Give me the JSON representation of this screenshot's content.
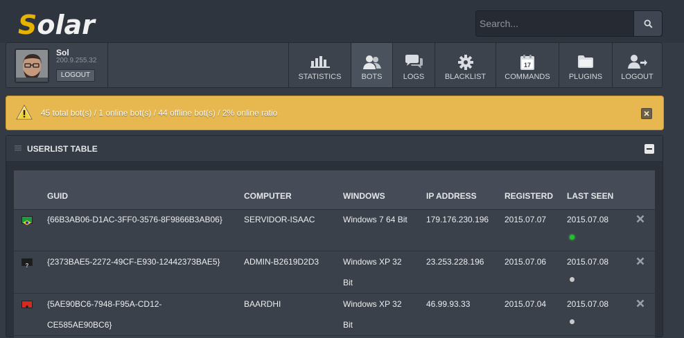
{
  "app": {
    "logo_rest": "olar",
    "logo_first": "S"
  },
  "search": {
    "placeholder": "Search..."
  },
  "user": {
    "name": "Sol",
    "ip": "200.9.255.32",
    "logout_label": "LOGOUT"
  },
  "nav": [
    {
      "label": "STATISTICS",
      "icon": "bar-chart-icon"
    },
    {
      "label": "BOTS",
      "icon": "users-icon",
      "active": true
    },
    {
      "label": "LOGS",
      "icon": "chat-bubbles-icon"
    },
    {
      "label": "BLACKLIST",
      "icon": "gear-icon"
    },
    {
      "label": "COMMANDS",
      "icon": "calendar-icon",
      "badge": "17"
    },
    {
      "label": "PLUGINS",
      "icon": "folder-icon"
    },
    {
      "label": "LOGOUT",
      "icon": "user-logout-icon"
    }
  ],
  "alert": {
    "text": "45 total bot(s) / 1 online bot(s) / 44 offline bot(s) / 2% online ratio"
  },
  "panel": {
    "title": "USERLIST TABLE"
  },
  "table": {
    "headers": [
      "GUID",
      "COMPUTER",
      "WINDOWS",
      "IP ADDRESS",
      "REGISTERD",
      "LAST SEEN"
    ],
    "rows": [
      {
        "flag": "brazil",
        "guid_1": "{66B3AB06-D1AC-3FF0-3576-8F9866B3AB06}",
        "guid_2": "",
        "computer": "SERVIDOR-ISAAC",
        "windows_1": "Windows 7 64 Bit",
        "windows_2": "",
        "ip": "179.176.230.196",
        "registered": "2015.07.07",
        "last_seen": "2015.07.08",
        "status": "online"
      },
      {
        "flag": "unknown",
        "guid_1": "{2373BAE5-2272-49CF-E930-12442373BAE5}",
        "guid_2": "",
        "computer": "ADMIN-B2619D2D3",
        "windows_1": "Windows XP 32",
        "windows_2": "Bit",
        "ip": "23.253.228.196",
        "registered": "2015.07.06",
        "last_seen": "2015.07.08",
        "status": "offline"
      },
      {
        "flag": "albania",
        "guid_1": "{5AE90BC6-7948-F95A-CD12-",
        "guid_2": "CE585AE90BC6}",
        "computer": "BAARDHI",
        "windows_1": "Windows XP 32",
        "windows_2": "Bit",
        "ip": "46.99.93.33",
        "registered": "2015.07.04",
        "last_seen": "2015.07.08",
        "status": "offline"
      }
    ]
  },
  "colors": {
    "online": "#22c02a",
    "offline": "#c8c8c8",
    "alert_bg": "#e6b84f",
    "accent": "#e6b300"
  }
}
